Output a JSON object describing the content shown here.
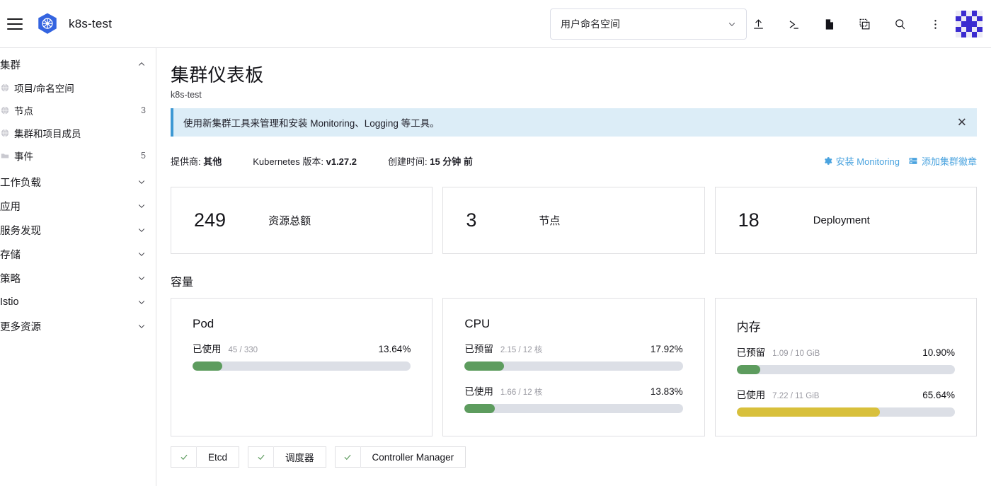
{
  "header": {
    "brand": "k8s-test",
    "namespace_selector": {
      "value": "用户命名空间"
    },
    "tools": [
      "upload-icon",
      "terminal-icon",
      "file-icon",
      "kubectl-shell-icon",
      "search-icon",
      "kebab-menu-icon"
    ]
  },
  "sidebar": {
    "groups": [
      {
        "label": "集群",
        "expanded": true,
        "items": [
          {
            "label": "项目/命名空间",
            "icon": "globe-icon",
            "count": ""
          },
          {
            "label": "节点",
            "icon": "globe-icon",
            "count": "3"
          },
          {
            "label": "集群和项目成员",
            "icon": "globe-icon",
            "count": ""
          },
          {
            "label": "事件",
            "icon": "folder-icon",
            "count": "5"
          }
        ]
      },
      {
        "label": "工作负载",
        "expanded": false,
        "items": []
      },
      {
        "label": "应用",
        "expanded": false,
        "items": []
      },
      {
        "label": "服务发现",
        "expanded": false,
        "items": []
      },
      {
        "label": "存储",
        "expanded": false,
        "items": []
      },
      {
        "label": "策略",
        "expanded": false,
        "items": []
      },
      {
        "label": "Istio",
        "expanded": false,
        "items": []
      },
      {
        "label": "更多资源",
        "expanded": false,
        "items": []
      }
    ]
  },
  "page": {
    "title": "集群仪表板",
    "subtitle": "k8s-test",
    "banner": {
      "text": "使用新集群工具来管理和安装 Monitoring、Logging 等工具。",
      "close": "✕"
    },
    "meta": [
      {
        "label": "提供商:",
        "value": "其他"
      },
      {
        "label": "Kubernetes 版本:",
        "value": "v1.27.2"
      },
      {
        "label": "创建时间:",
        "value": "15 分钟 前"
      }
    ],
    "actions": [
      {
        "label": "安装 Monitoring",
        "icon": "gear-icon"
      },
      {
        "label": "添加集群徽章",
        "icon": "badge-icon"
      }
    ],
    "stats": [
      {
        "value": "249",
        "label": "资源总额"
      },
      {
        "value": "3",
        "label": "节点"
      },
      {
        "value": "18",
        "label": "Deployment"
      }
    ],
    "capacity_heading": "容量",
    "capacity": [
      {
        "title": "Pod",
        "bars": [
          {
            "label": "已使用",
            "detail": "45 / 330",
            "percent": "13.64%",
            "value": 13.64,
            "color": "#5d9c5e"
          }
        ]
      },
      {
        "title": "CPU",
        "bars": [
          {
            "label": "已预留",
            "detail": "2.15 / 12 核",
            "percent": "17.92%",
            "value": 17.92,
            "color": "#5d9c5e"
          },
          {
            "label": "已使用",
            "detail": "1.66 / 12 核",
            "percent": "13.83%",
            "value": 13.83,
            "color": "#5d9c5e"
          }
        ]
      },
      {
        "title": "内存",
        "bars": [
          {
            "label": "已预留",
            "detail": "1.09 / 10 GiB",
            "percent": "10.90%",
            "value": 10.9,
            "color": "#5d9c5e"
          },
          {
            "label": "已使用",
            "detail": "7.22 / 11 GiB",
            "percent": "65.64%",
            "value": 65.64,
            "color": "#d8c03c"
          }
        ]
      }
    ],
    "components": [
      {
        "name": "Etcd",
        "status": "healthy"
      },
      {
        "name": "调度器",
        "status": "healthy"
      },
      {
        "name": "Controller Manager",
        "status": "healthy"
      }
    ]
  },
  "colors": {
    "accent": "#4aa3df",
    "ok": "#5d9c5e",
    "warn": "#d8c03c",
    "track": "#dcdfe6",
    "banner_bg": "#dcedf7"
  }
}
